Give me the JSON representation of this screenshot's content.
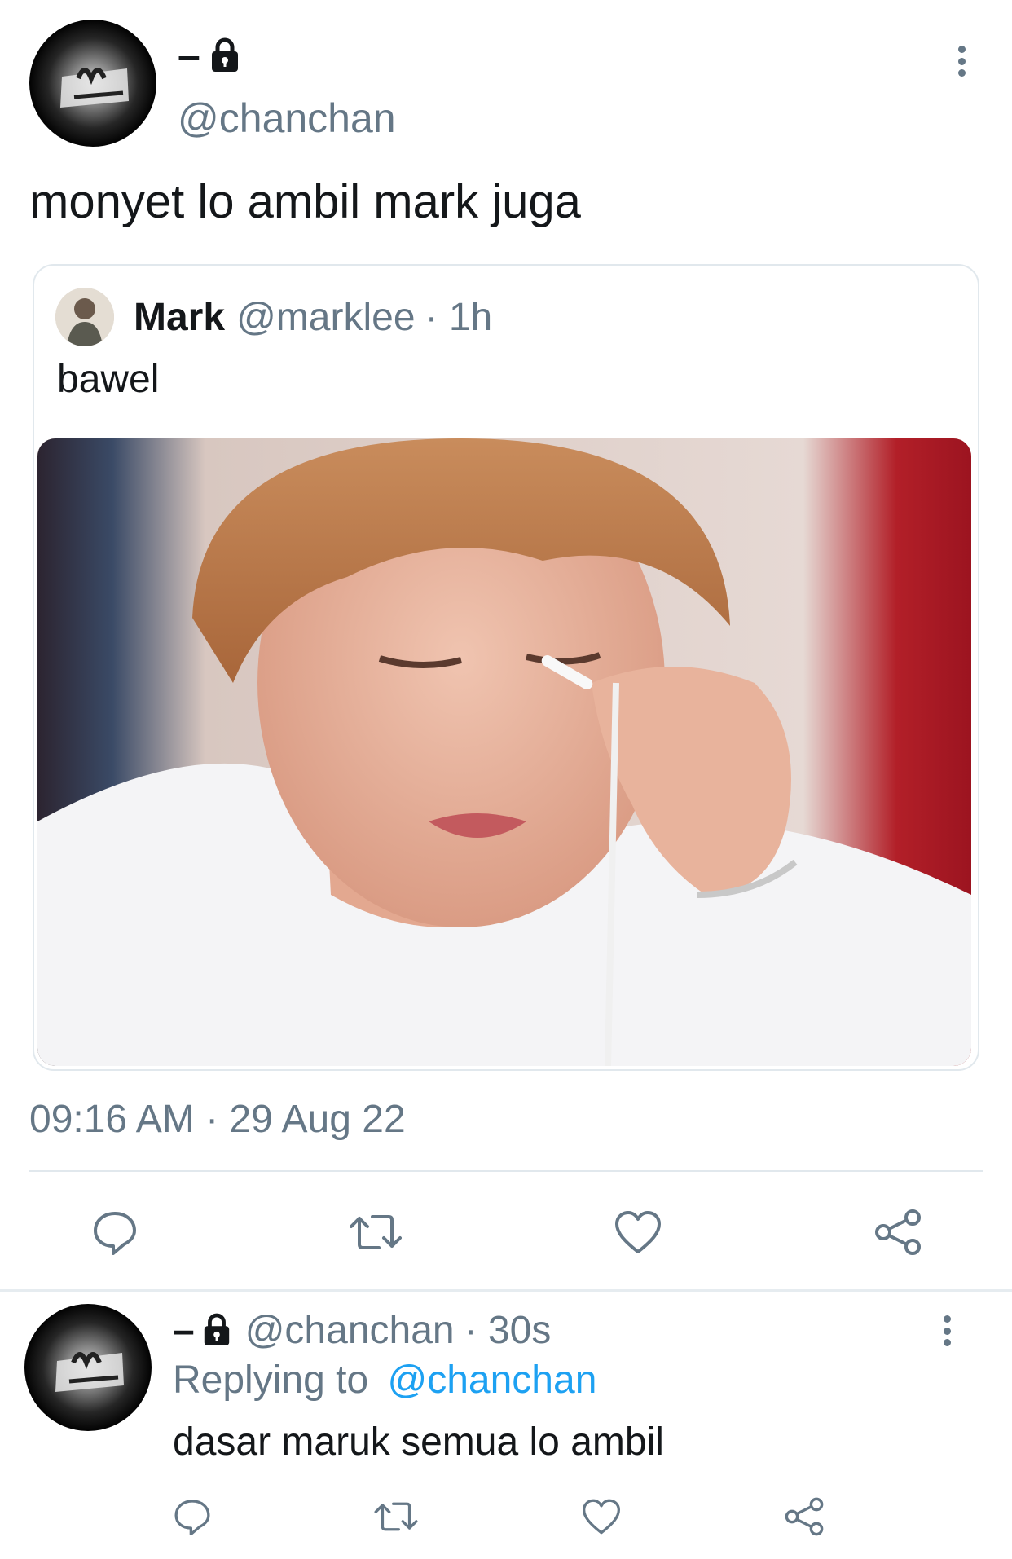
{
  "tweet": {
    "author": {
      "display_name": "–",
      "handle": "@chanchan",
      "avatar_icon": "graffiti-avatar-icon",
      "locked_icon": "lock-icon"
    },
    "text": "monyet lo ambil mark juga",
    "quote": {
      "name": "Mark",
      "handle": "@marklee",
      "time": "· 1h",
      "text": "bawel"
    },
    "timestamp": "09:16 AM · 29 Aug 22",
    "actions": [
      "reply-icon",
      "retweet-icon",
      "like-icon",
      "share-icon"
    ]
  },
  "reply": {
    "author": {
      "display_name": "–",
      "handle": "@chanchan",
      "time": "· 30s"
    },
    "replying_prefix": "Replying to",
    "replying_to": "@chanchan",
    "text": "dasar maruk semua lo ambil",
    "actions": [
      "reply-icon",
      "retweet-icon",
      "like-icon",
      "share-icon"
    ]
  },
  "colors": {
    "secondary_text": "#657786",
    "link": "#1da1f2",
    "border": "#e1e8ed"
  }
}
